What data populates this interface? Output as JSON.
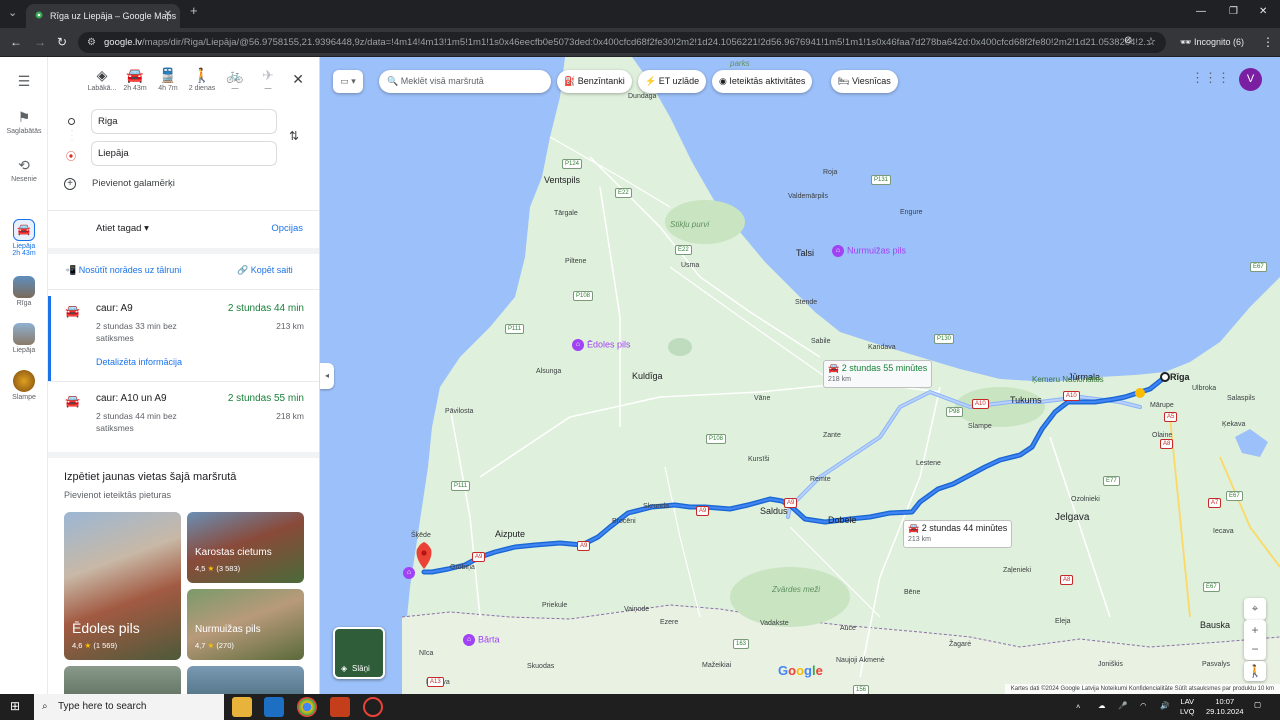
{
  "browser": {
    "tab_title": "Rīga uz Liepāja – Google Maps",
    "url_host": "google.lv",
    "url_path": "/maps/dir/Riga/Liepāja/@56.9758155,21.9396448,9z/data=!4m14!4m13!1m5!1m1!1s0x46eecfb0e5073ded:0x400cfcd68f2fe30!2m2!1d24.1056221!2d56.9676941!1m5!1m1!1s0x46faa7d278ba642d:0x400cfcd68f2fe80!2m2!1d21.0538204!2...",
    "incognito_label": "Incognito (6)"
  },
  "rail": {
    "saved": "Saglabātās",
    "recent": "Nesenie",
    "active_label": "Liepāja",
    "active_sub": "2h 43m",
    "riga": "Rīga",
    "liepaja": "Liepāja",
    "slampe": "Slampe"
  },
  "modes": [
    {
      "label": "Labākā..."
    },
    {
      "label": "2h 43m"
    },
    {
      "label": "4h 7m"
    },
    {
      "label": "2 dienas"
    },
    {
      "label": "—"
    },
    {
      "label": "—"
    }
  ],
  "directions": {
    "origin": "Riga",
    "destination": "Liepāja",
    "add_stop": "Pievienot galamērķi",
    "depart": "Atiet tagad",
    "options": "Opcijas",
    "send_phone": "Nosūtīt norādes uz tālruni",
    "copy_link": "Kopēt saiti"
  },
  "routes": [
    {
      "via": "caur: A9",
      "time": "2 stundas 44 min",
      "sub": "2 stundas 33 min bez satiksmes",
      "km": "213 km",
      "details": "Detalizēta informācija"
    },
    {
      "via": "caur: A10 un A9",
      "time": "2 stundas 55 min",
      "sub": "2 stundas 44 min bez satiksmes",
      "km": "218 km"
    }
  ],
  "explore": {
    "title": "Izpētiet jaunas vietas šajā maršrutā",
    "subtitle": "Pievienot ieteiktās pieturas",
    "cards": [
      {
        "name": "Ēdoles pils",
        "rating": "4,6",
        "count": "(1 569)"
      },
      {
        "name": "Karostas cietums",
        "rating": "4,5",
        "count": "(3 583)"
      },
      {
        "name": "Nurmuižas pils",
        "rating": "4,7",
        "count": "(270)"
      }
    ]
  },
  "map": {
    "search_placeholder": "Meklēt visā maršrutā",
    "chips": [
      "Benzīntanki",
      "ET uzlāde",
      "Ieteiktās aktivitātes",
      "Viesnīcas"
    ],
    "avatar": "V",
    "route_tip_main": {
      "time": "2 stundas 44 minūtes",
      "km": "213 km"
    },
    "route_tip_alt": {
      "time": "2 stundas 55 minūtes",
      "km": "218 km"
    },
    "layers_label": "Slāņi",
    "footer": "Kartes dati ©2024 Google   Latvija   Noteikumi   Konfidencialitāte   Sūtīt atsauksmes par produktu   10 km",
    "google": "Google",
    "places": {
      "riga": "Rīga",
      "jelgava": "Jelgava",
      "jurmala": "Jūrmala",
      "saldus": "Saldus",
      "kuldiga": "Kuldīga",
      "talsi": "Talsi",
      "ventspils": "Ventspils",
      "tukums": "Tukums",
      "dobele": "Dobele",
      "aizpute": "Aizpute",
      "skrunda": "Skrunda",
      "broceni": "Brocēni",
      "grobina": "Grobiņa",
      "pavilosta": "Pāvilosta",
      "priekule": "Priekule",
      "olaine": "Olaine",
      "kemeri": "Ķemeru Nacionālais",
      "sloka": "Sloka",
      "engure": "Engure",
      "dundaga": "Dundaga",
      "valdemarpils": "Valdemārpils",
      "rojas": "Roja",
      "kandava": "Kandava",
      "sabile": "Sabile",
      "usma": "Usma",
      "piltene": "Piltene",
      "targale": "Tārgale",
      "alsunga": "Alsunga",
      "skede": "Šķēde",
      "nica": "Nīca",
      "rucava": "Rucava",
      "barta": "Bārta",
      "vainode": "Vaiņode",
      "zvardes": "Zvārdes meži",
      "bauska": "Bauska",
      "iecava": "Iecava",
      "kekava": "Ķekava",
      "marupe": "Mārupe",
      "ulbroka": "Ulbroka",
      "salaspils": "Salaspils",
      "ozolnieki": "Ozolnieki",
      "zalenieki": "Zaļenieki",
      "eleja": "Eleja",
      "auce": "Auce",
      "bene": "Bēne",
      "vecauce": "Vecauce",
      "stende": "Stende",
      "lestene": "Lestene",
      "slampe": "Slampe",
      "zante": "Zante",
      "vane": "Vāne",
      "remte": "Remte",
      "kursisi": "Kursīši",
      "vadakste": "Vadakste",
      "ezere": "Ezere",
      "skuodas": "Skuodas",
      "mazeikiai": "Mažeikiai",
      "naujoji": "Naujoji Akmenė",
      "zagare": "Žagarė",
      "joniskis": "Joniškis",
      "pasvalys": "Pasvalys",
      "stikli": "Stikļu purvi",
      "parks": "parks",
      "edole": "Ēdoles pils",
      "nurmuiza": "Nurmuižas pils",
      "barta_poi": "Bārta"
    }
  }
}
